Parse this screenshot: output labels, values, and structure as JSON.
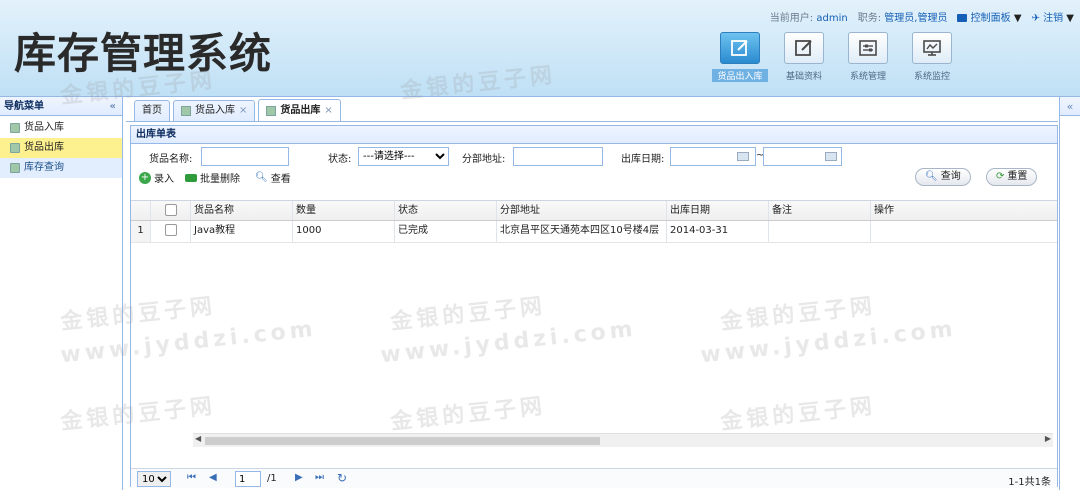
{
  "header": {
    "logo": "库存管理系统",
    "current_user_label": "当前用户:",
    "current_user": "admin",
    "role_label": "职务:",
    "role": "管理员,管理员",
    "control_panel": "控制面板",
    "logout": "注销",
    "top_buttons": [
      {
        "label": "货品出入库",
        "icon": "edit-icon"
      },
      {
        "label": "基础资料",
        "icon": "edit-icon"
      },
      {
        "label": "系统管理",
        "icon": "settings-panel-icon"
      },
      {
        "label": "系统监控",
        "icon": "monitor-icon"
      }
    ]
  },
  "nav": {
    "title": "导航菜单",
    "collapse": "«",
    "items": [
      {
        "label": "货品入库"
      },
      {
        "label": "货品出库"
      },
      {
        "label": "库存查询"
      }
    ]
  },
  "tabs": [
    {
      "label": "首页"
    },
    {
      "label": "货品入库"
    },
    {
      "label": "货品出库"
    }
  ],
  "tab_close": "×",
  "panel": {
    "title": "出库单表",
    "filters": {
      "name_label": "货品名称:",
      "status_label": "状态:",
      "status_selected": "---请选择---",
      "address_label": "分部地址:",
      "date_label": "出库日期:",
      "date_sep": "~"
    },
    "toolbar": {
      "add": "录入",
      "batch_delete": "批量删除",
      "view": "查看",
      "query": "查询",
      "reset": "重置"
    }
  },
  "table": {
    "columns": [
      "货品名称",
      "数量",
      "状态",
      "分部地址",
      "出库日期",
      "备注",
      "操作"
    ],
    "rows": [
      {
        "index": "1",
        "name": "Java教程",
        "qty": "1000",
        "status": "已完成",
        "address": "北京昌平区天通苑本四区10号楼4层",
        "date": "2014-03-31",
        "note": "",
        "op": ""
      }
    ]
  },
  "pager": {
    "page_size": "10",
    "page": "1",
    "total_pages": "/1",
    "summary": "1-1共1条"
  },
  "east_collapse": "«",
  "watermarks": [
    "金银的豆子网",
    "www.jyddzi.com"
  ]
}
